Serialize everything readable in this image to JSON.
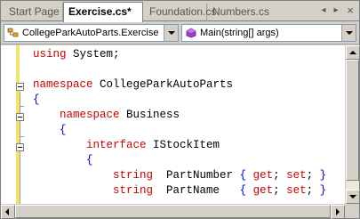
{
  "tabs": [
    {
      "label": "Start Page",
      "active": false
    },
    {
      "label": "Exercise.cs*",
      "active": true
    },
    {
      "label": "Foundation.cs",
      "active": false
    },
    {
      "label": "Numbers.cs",
      "active": false
    }
  ],
  "tab_nav": {
    "prev": "◂",
    "next": "▸",
    "close": "×"
  },
  "navbar": {
    "type_combo": {
      "value": "CollegeParkAutoParts.Exercise",
      "icon": "class-icon"
    },
    "member_combo": {
      "value": "Main(string[] args)",
      "icon": "method-icon"
    }
  },
  "code": [
    {
      "tokens": [
        {
          "t": "using",
          "c": "kw2"
        },
        {
          "t": " System;",
          "c": ""
        }
      ]
    },
    {
      "tokens": []
    },
    {
      "tokens": [
        {
          "t": "namespace",
          "c": "kw2"
        },
        {
          "t": " CollegeParkAutoParts",
          "c": ""
        }
      ]
    },
    {
      "tokens": [
        {
          "t": "{",
          "c": "brace"
        }
      ]
    },
    {
      "tokens": [
        {
          "t": "    ",
          "c": ""
        },
        {
          "t": "namespace",
          "c": "kw2"
        },
        {
          "t": " Business",
          "c": ""
        }
      ]
    },
    {
      "tokens": [
        {
          "t": "    ",
          "c": ""
        },
        {
          "t": "{",
          "c": "brace"
        }
      ]
    },
    {
      "tokens": [
        {
          "t": "        ",
          "c": ""
        },
        {
          "t": "interface",
          "c": "kw2"
        },
        {
          "t": " IStockItem",
          "c": ""
        }
      ]
    },
    {
      "tokens": [
        {
          "t": "        ",
          "c": ""
        },
        {
          "t": "{",
          "c": "brace"
        }
      ]
    },
    {
      "tokens": [
        {
          "t": "            ",
          "c": ""
        },
        {
          "t": "string",
          "c": "kw2"
        },
        {
          "t": "  PartNumber ",
          "c": ""
        },
        {
          "t": "{",
          "c": "brace"
        },
        {
          "t": " ",
          "c": ""
        },
        {
          "t": "get",
          "c": "kw2"
        },
        {
          "t": "; ",
          "c": ""
        },
        {
          "t": "set",
          "c": "kw2"
        },
        {
          "t": "; ",
          "c": ""
        },
        {
          "t": "}",
          "c": "brace"
        }
      ]
    },
    {
      "tokens": [
        {
          "t": "            ",
          "c": ""
        },
        {
          "t": "string",
          "c": "kw2"
        },
        {
          "t": "  PartName   ",
          "c": ""
        },
        {
          "t": "{",
          "c": "brace"
        },
        {
          "t": " ",
          "c": ""
        },
        {
          "t": "get",
          "c": "kw2"
        },
        {
          "t": "; ",
          "c": ""
        },
        {
          "t": "set",
          "c": "kw2"
        },
        {
          "t": "; ",
          "c": ""
        },
        {
          "t": "}",
          "c": "brace"
        }
      ]
    }
  ],
  "colors": {
    "keyword": "#cc0000",
    "brace": "#0000cc",
    "text": "#000000",
    "change_bar": "#f3e36b"
  }
}
